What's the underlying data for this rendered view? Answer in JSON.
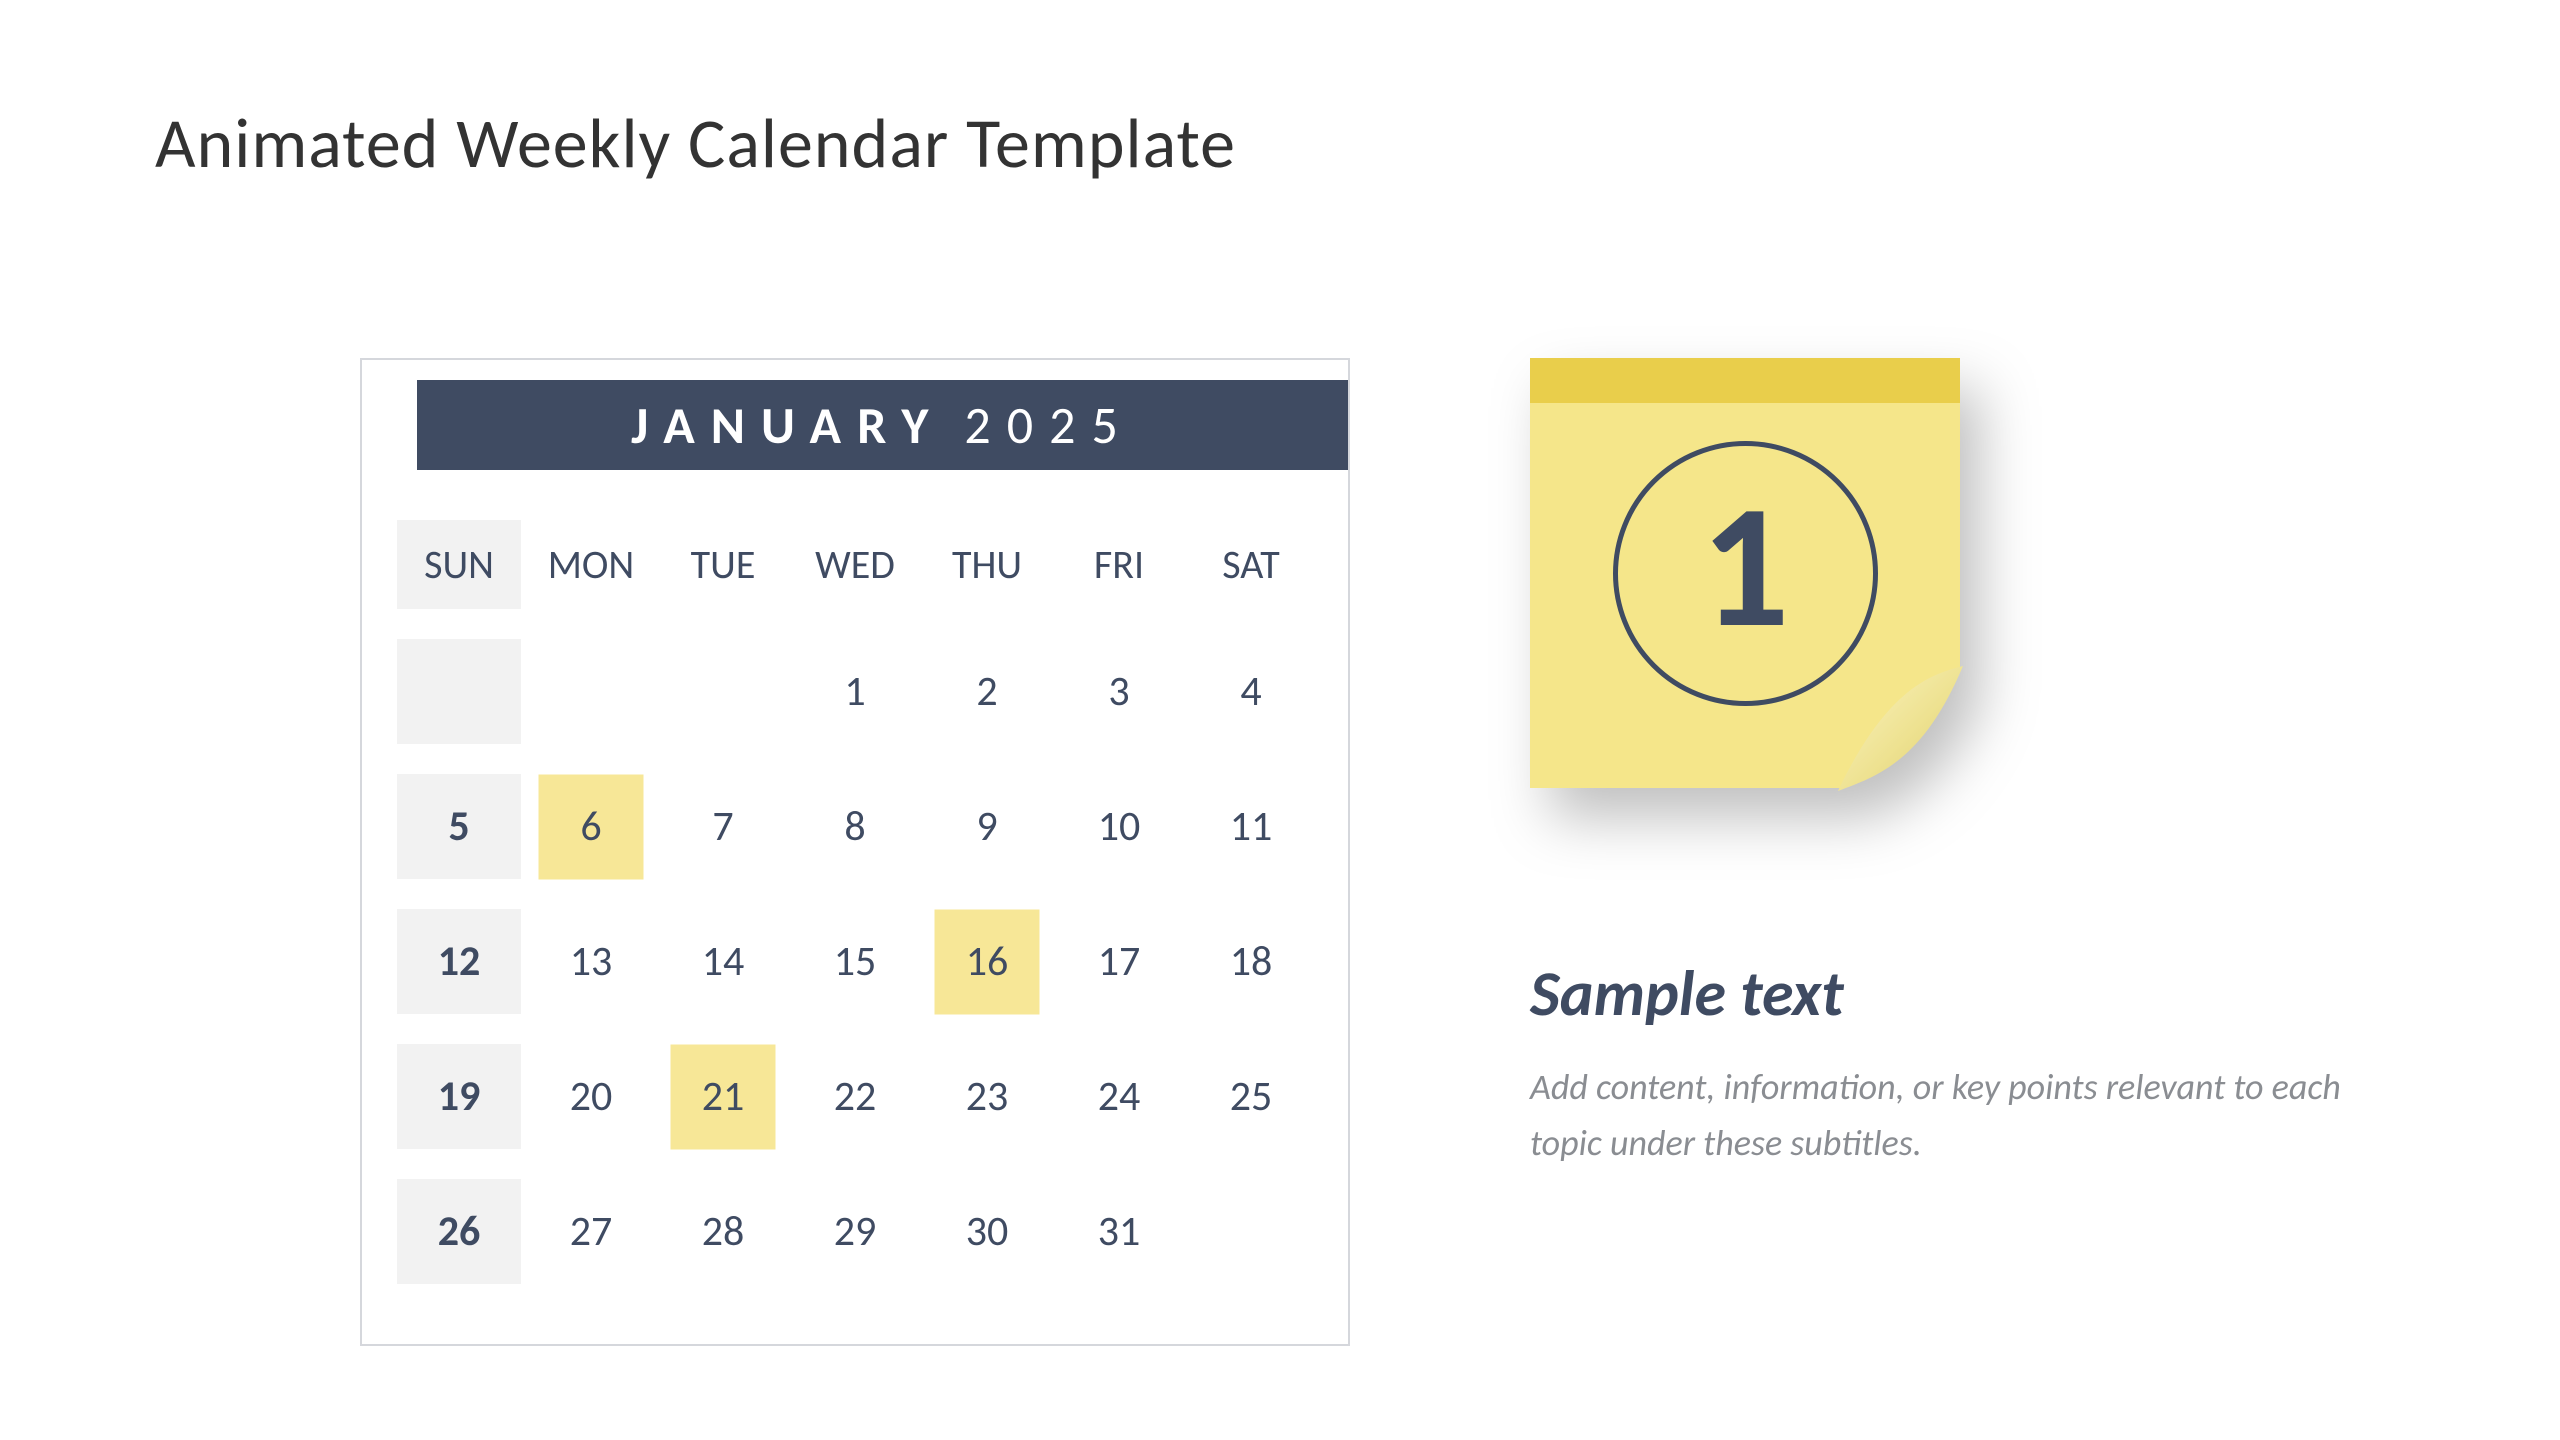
{
  "page": {
    "title": "Animated Weekly Calendar Template"
  },
  "calendar": {
    "month": "JANUARY",
    "year": "2025",
    "day_headers": [
      "SUN",
      "MON",
      "TUE",
      "WED",
      "THU",
      "FRI",
      "SAT"
    ],
    "weeks": [
      [
        null,
        null,
        null,
        "1",
        "2",
        "3",
        "4"
      ],
      [
        "5",
        "6",
        "7",
        "8",
        "9",
        "10",
        "11"
      ],
      [
        "12",
        "13",
        "14",
        "15",
        "16",
        "17",
        "18"
      ],
      [
        "19",
        "20",
        "21",
        "22",
        "23",
        "24",
        "25"
      ],
      [
        "26",
        "27",
        "28",
        "29",
        "30",
        "31",
        null
      ]
    ],
    "highlighted": [
      "6",
      "16",
      "21"
    ]
  },
  "sticky": {
    "number": "1"
  },
  "note": {
    "title": "Sample text",
    "body": "Add content, information, or key points relevant to each topic under these subtitles."
  },
  "colors": {
    "slate": "#3f4b62",
    "highlight": "#f7e797",
    "sticky_body": "#f5e68a",
    "sticky_top": "#e9ce4b"
  }
}
